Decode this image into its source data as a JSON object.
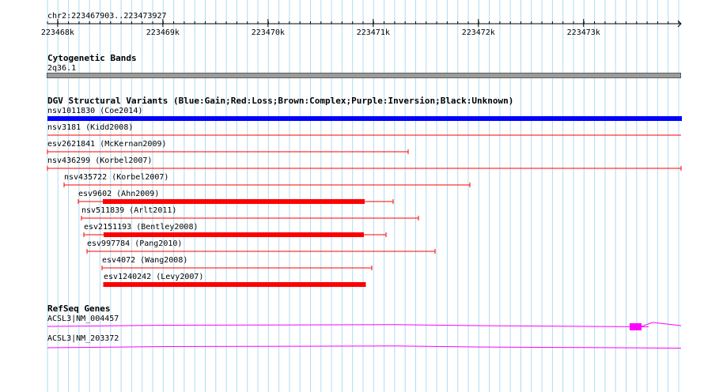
{
  "ruler": {
    "region": "chr2:223467903..223473927",
    "ticks": [
      {
        "label": "223468k",
        "pos": 223468000
      },
      {
        "label": "223469k",
        "pos": 223469000
      },
      {
        "label": "223470k",
        "pos": 223470000
      },
      {
        "label": "223471k",
        "pos": 223471000
      },
      {
        "label": "223472k",
        "pos": 223472000
      },
      {
        "label": "223473k",
        "pos": 223473000
      }
    ]
  },
  "cytobands": {
    "title": "Cytogenetic Bands",
    "band": "2q36.1"
  },
  "dgv": {
    "title": "DGV Structural Variants (Blue:Gain;Red:Loss;Brown:Complex;Purple:Inversion;Black:Unknown)",
    "colors": {
      "gain": "#0000ff",
      "loss": "#ff0000"
    },
    "variants": [
      {
        "label": "nsv1011830 (Coe2014)",
        "type": "gain",
        "start": 223467903,
        "end": 223473927,
        "thick_start": 223467903,
        "thick_end": 223473927
      },
      {
        "label": "nsv3181 (Kidd2008)",
        "type": "loss",
        "start": 223467903,
        "end": 223473927
      },
      {
        "label": "esv2621841 (McKernan2009)",
        "type": "loss",
        "start": 223467903,
        "end": 223471330
      },
      {
        "label": "nsv436299 (Korbel2007)",
        "type": "loss",
        "start": 223467903,
        "end": 223473927
      },
      {
        "label": "nsv435722 (Korbel2007)",
        "type": "loss",
        "start": 223468060,
        "end": 223471920
      },
      {
        "label": "esv9602 (Ahn2009)",
        "type": "loss",
        "start": 223468200,
        "end": 223471190,
        "thick_start": 223468430,
        "thick_end": 223470920
      },
      {
        "label": "nsv511839 (Arlt2011)",
        "type": "loss",
        "start": 223468230,
        "end": 223471430
      },
      {
        "label": "esv2151193 (Bentley2008)",
        "type": "loss",
        "start": 223468250,
        "end": 223471120,
        "thick_start": 223468440,
        "thick_end": 223470910
      },
      {
        "label": "esv997784 (Pang2010)",
        "type": "loss",
        "start": 223468280,
        "end": 223471590
      },
      {
        "label": "esv4072 (Wang2008)",
        "type": "loss",
        "start": 223468420,
        "end": 223470990
      },
      {
        "label": "esv1240242 (Levy2007)",
        "type": "loss",
        "start": 223468440,
        "end": 223470930,
        "thick_start": 223468440,
        "thick_end": 223470930
      }
    ]
  },
  "refseq": {
    "title": "RefSeq Genes",
    "color": "#ff00ff",
    "genes": [
      {
        "label": "ACSL3|NM_004457",
        "exon_start": 223473440,
        "exon_end": 223473550
      },
      {
        "label": "ACSL3|NM_203372"
      }
    ]
  }
}
